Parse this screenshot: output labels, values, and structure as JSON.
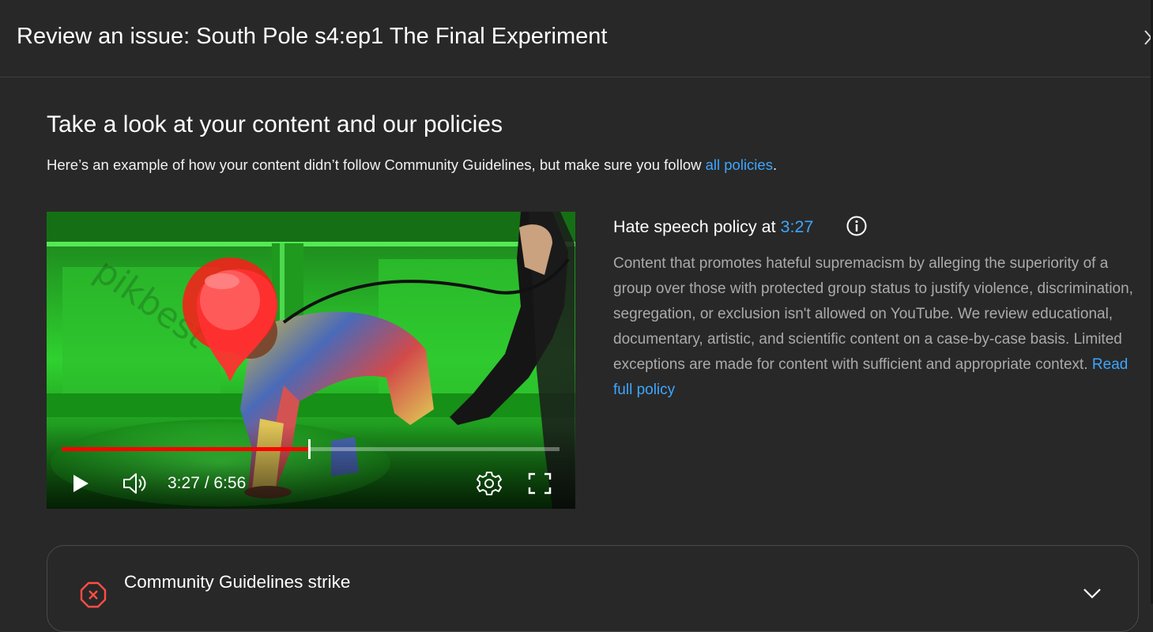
{
  "dialog": {
    "title": "Review an issue: South Pole s4:ep1 The Final Experiment",
    "close_icon": "close-icon"
  },
  "section": {
    "title": "Take a look at your content and our policies",
    "description": "Here’s an example of how your content didn’t follow Community Guidelines, but make sure you follow ",
    "link_text": "all policies",
    "description_end": "."
  },
  "player": {
    "current_time": "3:27",
    "duration": "6:56",
    "time_display": "3:27 / 6:56",
    "progress_fraction": 0.4976,
    "watermark": "pikbest",
    "icons": [
      "play-icon",
      "volume-icon",
      "settings-icon",
      "fullscreen-icon"
    ]
  },
  "policy": {
    "title_prefix": "Hate speech policy at ",
    "timestamp": "3:27",
    "info_icon": "info-icon",
    "body": "Content that promotes hateful supremacism by alleging the superiority of a group over those with protected group status to justify violence, discrimination, segregation, or exclusion isn't allowed on YouTube. We review educational, documentary, artistic, and scientific content on a case-by-case basis. Limited exceptions are made for content with sufficient and appropriate context. ",
    "read_more": "Read full policy"
  },
  "strike_card": {
    "title": "Community Guidelines strike",
    "icon": "strike-icon",
    "expand_icon": "chevron-down-icon"
  },
  "colors": {
    "background": "#282828",
    "link": "#3ea6ff",
    "progress": "#ff0000",
    "strike": "#ff4e45"
  }
}
